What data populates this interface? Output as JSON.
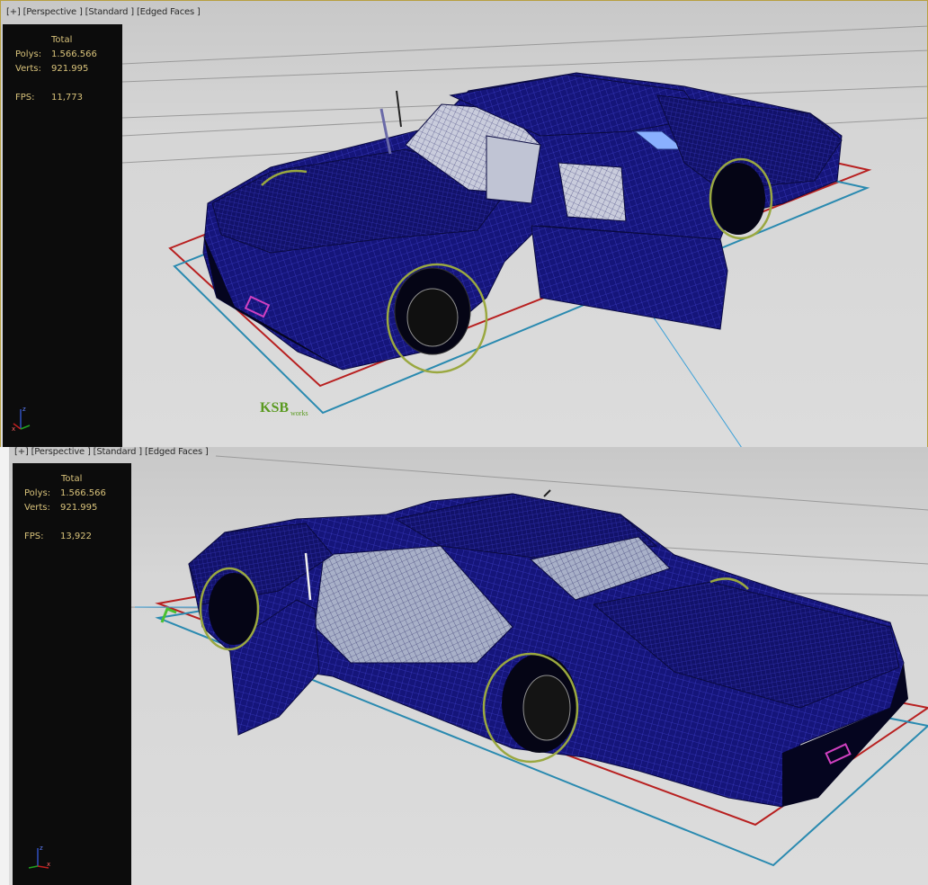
{
  "viewports": [
    {
      "label_items": [
        "[+]",
        "[Perspective ]",
        "[Standard ]",
        "[Edged Faces ]"
      ],
      "stats": {
        "header": "Total",
        "polys_label": "Polys:",
        "polys_value": "1.566.566",
        "verts_label": "Verts:",
        "verts_value": "921.995",
        "fps_label": "FPS:",
        "fps_value": "11,773"
      },
      "watermark": "KSB",
      "watermark_suffix": "works"
    },
    {
      "label_items": [
        "[+]",
        "[Perspective ]",
        "[Standard ]",
        "[Edged Faces ]"
      ],
      "stats": {
        "header": "Total",
        "polys_label": "Polys:",
        "polys_value": "1.566.566",
        "verts_label": "Verts:",
        "verts_value": "921.995",
        "fps_label": "FPS:",
        "fps_value": "13,922"
      }
    }
  ],
  "colors": {
    "car_body": "#1a1a8a",
    "wire": "#2a2aa8",
    "wheel_gizmo": "#9aa840",
    "bbox_red": "#b82020",
    "bbox_blue": "#2a8ab0",
    "stats_text": "#d8c27a"
  }
}
